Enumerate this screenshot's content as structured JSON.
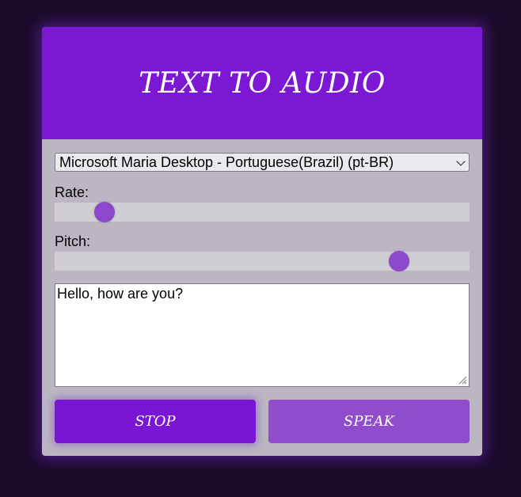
{
  "header": {
    "title": "TEXT TO AUDIO"
  },
  "voice": {
    "selected": "Microsoft Maria Desktop - Portuguese(Brazil) (pt-BR)"
  },
  "rate": {
    "label": "Rate:",
    "value_fraction": 0.12
  },
  "pitch": {
    "label": "Pitch:",
    "value_fraction": 0.83
  },
  "text_input": {
    "value": "Hello, how are you?"
  },
  "buttons": {
    "stop_label": "STOP",
    "speak_label": "SPEAK"
  },
  "colors": {
    "background": "#1b0b2b",
    "accent": "#7c17d4",
    "thumb": "#8c49cc",
    "card": "#bbb6c2"
  }
}
